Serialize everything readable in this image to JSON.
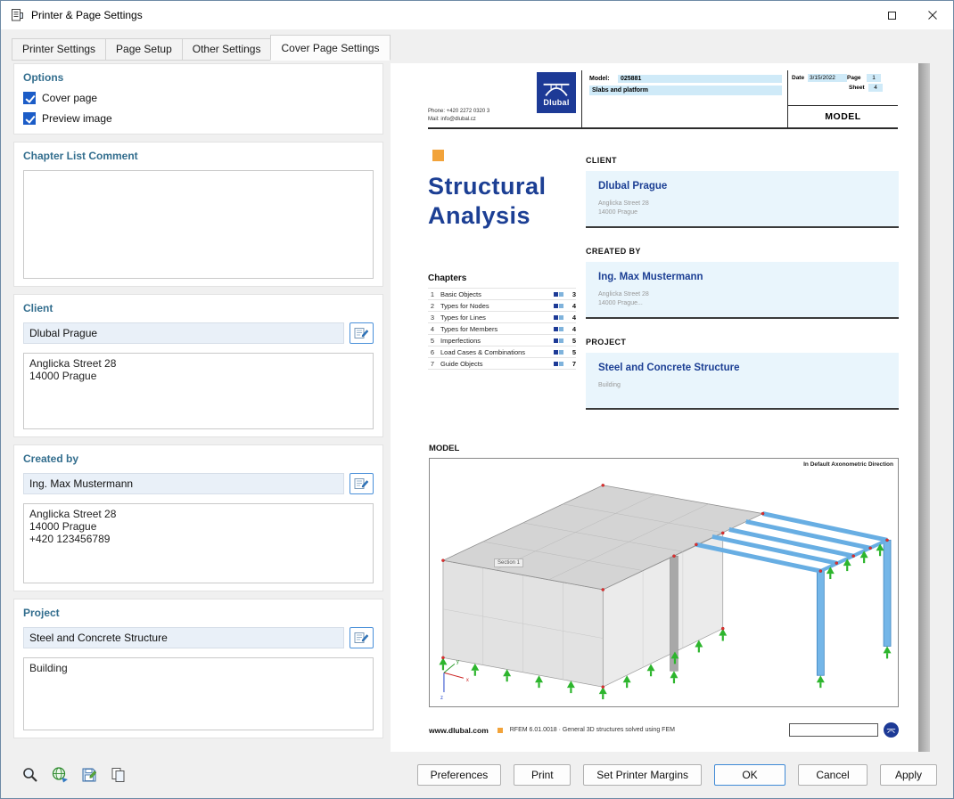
{
  "window": {
    "title": "Printer & Page Settings"
  },
  "tabs": [
    {
      "label": "Printer Settings"
    },
    {
      "label": "Page Setup"
    },
    {
      "label": "Other Settings"
    },
    {
      "label": "Cover Page Settings"
    }
  ],
  "left_panel": {
    "options": {
      "title": "Options",
      "cover_page_label": "Cover page",
      "cover_page_checked": true,
      "preview_image_label": "Preview image",
      "preview_image_checked": true
    },
    "chapter_list_comment": {
      "title": "Chapter List Comment",
      "value": ""
    },
    "client": {
      "title": "Client",
      "name": "Dlubal Prague",
      "address": "Anglicka Street 28\n14000 Prague"
    },
    "created_by": {
      "title": "Created by",
      "name": "Ing. Max Mustermann",
      "address": "Anglicka Street 28\n14000 Prague\n+420 123456789"
    },
    "project": {
      "title": "Project",
      "name": "Steel and Concrete Structure",
      "description": "Building"
    }
  },
  "preview": {
    "header": {
      "phone": "Phone: +420 2272 0320 3",
      "email": "Mail: info@dlubal.cz",
      "logo_text": "Dlubal",
      "model_label": "Model:",
      "model_value": "025881",
      "model_name": "Slabs and platform",
      "date_label": "Date",
      "date_value": "3/15/2022",
      "page_label": "Page",
      "page_value": "1",
      "sheet_label": "Sheet",
      "sheet_value": "4",
      "doc_type": "MODEL"
    },
    "title_line1": "Structural",
    "title_line2": "Analysis",
    "chapters": {
      "heading": "Chapters",
      "items": [
        {
          "num": "1",
          "label": "Basic Objects",
          "page": "3"
        },
        {
          "num": "2",
          "label": "Types for Nodes",
          "page": "4"
        },
        {
          "num": "3",
          "label": "Types for Lines",
          "page": "4"
        },
        {
          "num": "4",
          "label": "Types for Members",
          "page": "4"
        },
        {
          "num": "5",
          "label": "Imperfections",
          "page": "5"
        },
        {
          "num": "6",
          "label": "Load Cases & Combinations",
          "page": "5"
        },
        {
          "num": "7",
          "label": "Guide Objects",
          "page": "7"
        }
      ]
    },
    "sections": {
      "client": {
        "heading": "CLIENT",
        "name": "Dlubal Prague",
        "line1": "Anglicka Street 28",
        "line2": "14000 Prague"
      },
      "created_by": {
        "heading": "CREATED BY",
        "name": "Ing. Max Mustermann",
        "line1": "Anglicka Street 28",
        "line2": "14000 Prague..."
      },
      "project": {
        "heading": "PROJECT",
        "name": "Steel and Concrete Structure",
        "line1": "Building"
      }
    },
    "model": {
      "heading": "MODEL",
      "annotation": "In Default Axonometric Direction",
      "section_label": "Section 1",
      "axes": {
        "x": "x",
        "y": "y",
        "z": "z"
      }
    },
    "footer": {
      "website": "www.dlubal.com",
      "info": "RFEM 6.01.0018 · General 3D structures solved using FEM"
    }
  },
  "actions": {
    "preferences": "Preferences",
    "print": "Print",
    "set_printer_margins": "Set Printer Margins",
    "ok": "OK",
    "cancel": "Cancel",
    "apply": "Apply"
  },
  "colors": {
    "dlubal_blue": "#1d3a96",
    "group_title_teal": "#336e8e",
    "checkbox_blue": "#1b5cc7",
    "highlight_blue": "#cfeaf8",
    "section_box_blue": "#e9f5fc",
    "accent_orange": "#f2a33a",
    "member_blue": "#68aee3",
    "support_green": "#2db52d"
  }
}
